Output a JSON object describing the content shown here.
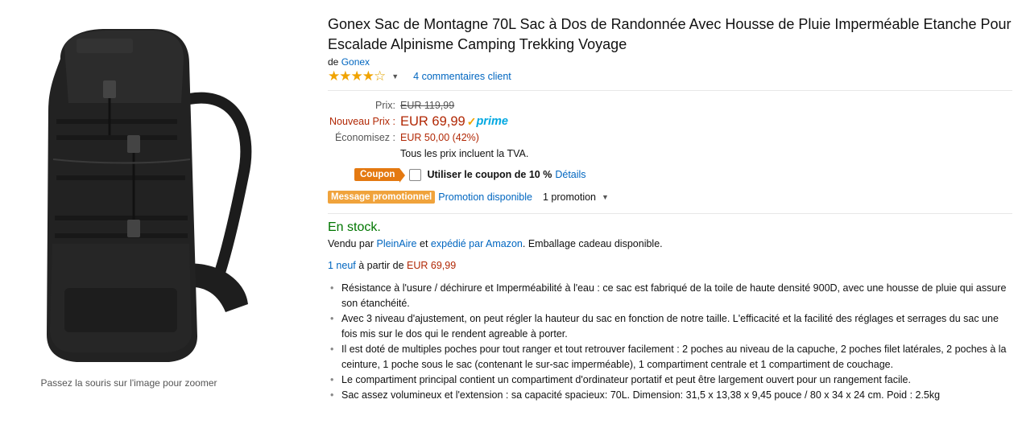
{
  "image": {
    "zoom_hint": "Passez la souris sur l'image pour zoomer"
  },
  "product": {
    "title": "Gonex Sac de Montagne 70L Sac à Dos de Randonnée Avec Housse de Pluie Imperméable Etanche Pour Escalade Alpinisme Camping Trekking Voyage",
    "by_label": "de",
    "brand": "Gonex",
    "rating": 4,
    "rating_max": 5,
    "reviews_link": "4 commentaires client"
  },
  "price": {
    "list_label": "Prix:",
    "list_price": "EUR 119,99",
    "new_label": "Nouveau Prix :",
    "new_price": "EUR 69,99",
    "prime": "prime",
    "savings_label": "Économisez :",
    "savings": "EUR 50,00 (42%)",
    "tax_note": "Tous les prix incluent la TVA."
  },
  "coupon": {
    "badge": "Coupon",
    "text": "Utiliser le coupon de 10 %",
    "details_link": "Détails",
    "checked": false
  },
  "promotion": {
    "badge": "Message promotionnel",
    "link": "Promotion disponible",
    "count": "1 promotion"
  },
  "availability": {
    "stock": "En stock.",
    "sold_by_prefix": "Vendu par",
    "seller": "PleinAire",
    "and": "et",
    "shipped_by": "expédié par Amazon",
    "gift": ". Emballage cadeau disponible."
  },
  "offers": {
    "count_link": "1 neuf",
    "from": "à partir de",
    "price": "EUR 69,99"
  },
  "features": [
    "Résistance à l'usure / déchirure et Imperméabilité à l'eau : ce sac est fabriqué de la toile de haute densité 900D, avec une housse de pluie qui assure son étanchéité.",
    "Avec 3 niveau d'ajustement, on peut régler la hauteur du sac en fonction de notre taille. L'efficacité et la facilité des réglages et serrages du sac une fois mis sur le dos qui le rendent agreable à porter.",
    "Il est doté de multiples poches pour tout ranger et tout retrouver facilement : 2 poches au niveau de la capuche, 2 poches filet latérales, 2 poches à la ceinture, 1 poche sous le sac (contenant le sur-sac imperméable), 1 compartiment centrale et 1 compartiment de couchage.",
    "Le compartiment principal contient un compartiment d'ordinateur portatif et peut être largement ouvert pour un rangement facile.",
    "Sac assez volumineux et l'extension : sa capacité spacieux: 70L. Dimension: 31,5 x 13,38 x 9,45 pouce / 80 x 34 x 24 cm. Poid : 2.5kg"
  ],
  "colors": {
    "price_red": "#b12704",
    "link_blue": "#0066c0",
    "stock_green": "#007600",
    "star": "#f0a300",
    "coupon_orange": "#e47911",
    "prime_blue": "#00a8e1"
  }
}
